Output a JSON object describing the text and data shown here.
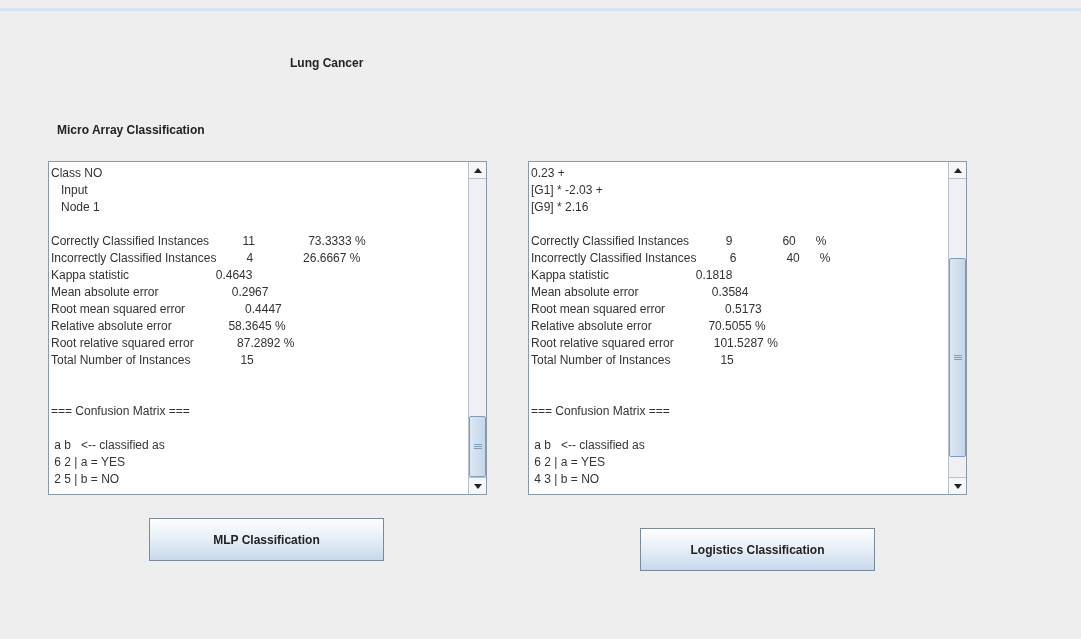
{
  "title": "Lung Cancer",
  "subtitle": "Micro Array Classification",
  "panels": [
    {
      "lines": [
        {
          "kind": "text",
          "text": "Class NO"
        },
        {
          "kind": "text",
          "text": "   Input"
        },
        {
          "kind": "text",
          "text": "   Node 1"
        },
        {
          "kind": "blank"
        },
        {
          "kind": "text",
          "text": "Correctly Classified Instances          11                73.3333 %"
        },
        {
          "kind": "text",
          "text": "Incorrectly Classified Instances         4               26.6667 %"
        },
        {
          "kind": "text",
          "text": "Kappa statistic                          0.4643"
        },
        {
          "kind": "text",
          "text": "Mean absolute error                      0.2967"
        },
        {
          "kind": "text",
          "text": "Root mean squared error                  0.4447"
        },
        {
          "kind": "text",
          "text": "Relative absolute error                 58.3645 %"
        },
        {
          "kind": "text",
          "text": "Root relative squared error             87.2892 %"
        },
        {
          "kind": "text",
          "text": "Total Number of Instances               15"
        },
        {
          "kind": "blank"
        },
        {
          "kind": "blank"
        },
        {
          "kind": "text",
          "text": "=== Confusion Matrix ==="
        },
        {
          "kind": "blank"
        },
        {
          "kind": "text",
          "text": " a b   <-- classified as"
        },
        {
          "kind": "text",
          "text": " 6 2 | a = YES"
        },
        {
          "kind": "text",
          "text": " 2 5 | b = NO"
        }
      ]
    },
    {
      "lines": [
        {
          "kind": "text",
          "text": "0.23 +"
        },
        {
          "kind": "text",
          "text": "[G1] * -2.03 +"
        },
        {
          "kind": "text",
          "text": "[G9] * 2.16"
        },
        {
          "kind": "blank"
        },
        {
          "kind": "text",
          "text": "Correctly Classified Instances           9               60      %"
        },
        {
          "kind": "text",
          "text": "Incorrectly Classified Instances          6               40      %"
        },
        {
          "kind": "text",
          "text": "Kappa statistic                          0.1818"
        },
        {
          "kind": "text",
          "text": "Mean absolute error                      0.3584"
        },
        {
          "kind": "text",
          "text": "Root mean squared error                  0.5173"
        },
        {
          "kind": "text",
          "text": "Relative absolute error                 70.5055 %"
        },
        {
          "kind": "text",
          "text": "Root relative squared error            101.5287 %"
        },
        {
          "kind": "text",
          "text": "Total Number of Instances               15"
        },
        {
          "kind": "blank"
        },
        {
          "kind": "blank"
        },
        {
          "kind": "text",
          "text": "=== Confusion Matrix ==="
        },
        {
          "kind": "blank"
        },
        {
          "kind": "text",
          "text": " a b   <-- classified as"
        },
        {
          "kind": "text",
          "text": " 6 2 | a = YES"
        },
        {
          "kind": "text",
          "text": " 4 3 | b = NO"
        }
      ]
    }
  ],
  "buttons": [
    {
      "label": "MLP Classification"
    },
    {
      "label": "Logistics Classification"
    }
  ]
}
